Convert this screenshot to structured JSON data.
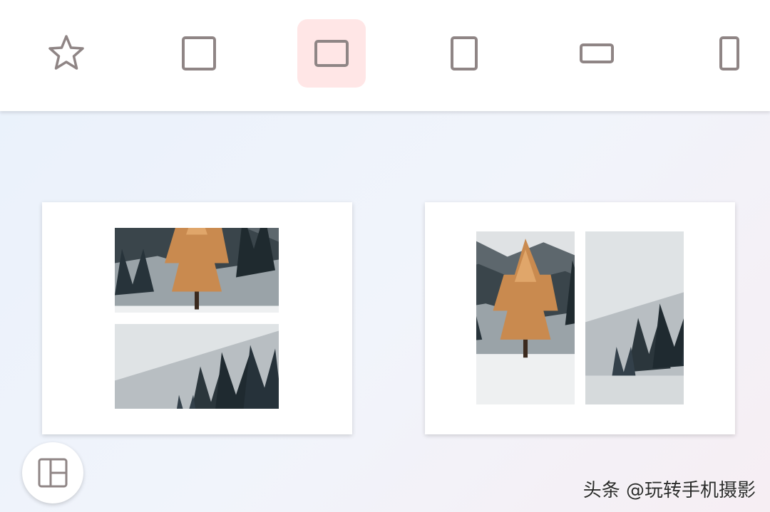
{
  "toolbar": {
    "aspect_options": [
      {
        "icon": "star-icon",
        "selected": false
      },
      {
        "icon": "square-icon",
        "selected": false
      },
      {
        "icon": "landscape-rect-icon",
        "selected": true
      },
      {
        "icon": "portrait-rect-icon",
        "selected": false
      },
      {
        "icon": "wide-rect-icon",
        "selected": false
      },
      {
        "icon": "tall-rect-icon",
        "selected": false
      }
    ],
    "icon_color": "#8f8585",
    "selected_bg": "#ffe6e6"
  },
  "layouts": [
    {
      "name": "two-horizontal-stack",
      "photos": [
        "orange-larch-tree",
        "snowy-forest-slope"
      ]
    },
    {
      "name": "two-vertical-side-by-side",
      "photos": [
        "orange-larch-tree",
        "snowy-forest-slope"
      ]
    }
  ],
  "layout_button": {
    "icon": "layout-grid-icon"
  },
  "watermark": {
    "text": "头条 @玩转手机摄影"
  }
}
